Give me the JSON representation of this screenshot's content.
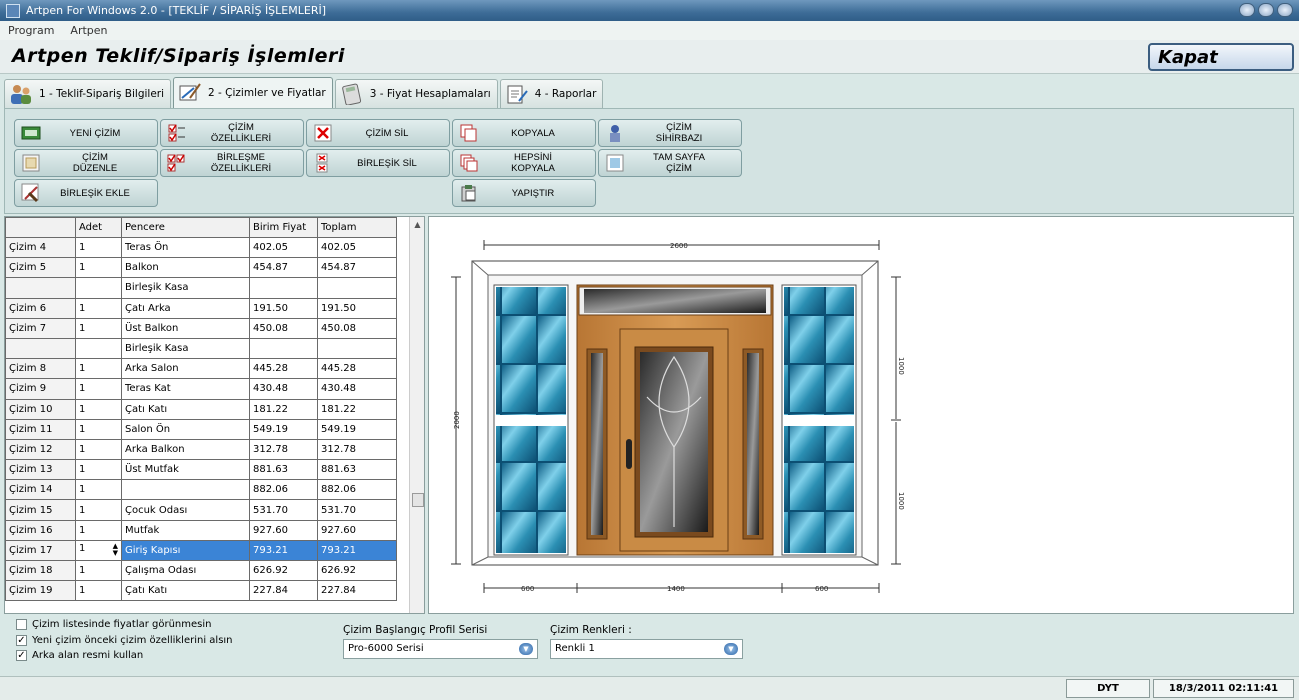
{
  "window": {
    "title": "Artpen For Windows 2.0 - [TEKLİF / SİPARİŞ İŞLEMLERİ]"
  },
  "menu": [
    "Program",
    "Artpen"
  ],
  "header": {
    "title": "Artpen Teklif/Sipariş İşlemleri",
    "close_label": "Kapat"
  },
  "tabs": [
    {
      "label": "1 - Teklif-Sipariş Bilgileri",
      "icon": "people-icon",
      "active": false
    },
    {
      "label": "2 - Çizimler ve Fiyatlar",
      "icon": "drawing-icon",
      "active": true
    },
    {
      "label": "3 - Fiyat Hesaplamaları",
      "icon": "calculator-icon",
      "active": false
    },
    {
      "label": "4 - Raporlar",
      "icon": "report-icon",
      "active": false
    }
  ],
  "toolbar": {
    "yeni_cizim": "YENİ ÇİZİM",
    "cizim_ozellikleri": "ÇİZİM\nÖZELLİKLERİ",
    "cizim_sil": "ÇİZİM SİL",
    "kopyala": "KOPYALA",
    "cizim_sihirbazi": "ÇİZİM\nSİHİRBAZI",
    "cizim_duzenle": "ÇİZİM\nDÜZENLE",
    "birlesme_ozellikleri": "BİRLEŞME\nÖZELLİKLERİ",
    "birlesik_sil": "BİRLEŞİK SİL",
    "hepsini_kopyala": "HEPSİNİ\nKOPYALA",
    "tam_sayfa_cizim": "TAM SAYFA\nÇİZİM",
    "birlesik_ekle": "BİRLEŞİK EKLE",
    "yapistir": "YAPIŞTIR"
  },
  "grid": {
    "columns": [
      "",
      "Adet",
      "Pencere",
      "Birim Fiyat",
      "Toplam"
    ],
    "rows": [
      [
        "Çizim 4",
        "1",
        "Teras Ön",
        "402.05",
        "402.05"
      ],
      [
        "Çizim 5",
        "1",
        "Balkon",
        "454.87",
        "454.87"
      ],
      [
        "",
        "",
        "Birleşik Kasa",
        "",
        ""
      ],
      [
        "Çizim 6",
        "1",
        "Çatı Arka",
        "191.50",
        "191.50"
      ],
      [
        "Çizim 7",
        "1",
        "Üst Balkon",
        "450.08",
        "450.08"
      ],
      [
        "",
        "",
        "Birleşik Kasa",
        "",
        ""
      ],
      [
        "Çizim 8",
        "1",
        "Arka Salon",
        "445.28",
        "445.28"
      ],
      [
        "Çizim 9",
        "1",
        "Teras Kat",
        "430.48",
        "430.48"
      ],
      [
        "Çizim 10",
        "1",
        "Çatı Katı",
        "181.22",
        "181.22"
      ],
      [
        "Çizim 11",
        "1",
        "Salon Ön",
        "549.19",
        "549.19"
      ],
      [
        "Çizim 12",
        "1",
        "Arka Balkon",
        "312.78",
        "312.78"
      ],
      [
        "Çizim 13",
        "1",
        "Üst Mutfak",
        "881.63",
        "881.63"
      ],
      [
        "Çizim 14",
        "1",
        "",
        "882.06",
        "882.06"
      ],
      [
        "Çizim 15",
        "1",
        "Çocuk Odası",
        "531.70",
        "531.70"
      ],
      [
        "Çizim 16",
        "1",
        "Mutfak",
        "927.60",
        "927.60"
      ],
      [
        "Çizim 17",
        "1",
        "Giriş Kapısı",
        "793.21",
        "793.21"
      ],
      [
        "Çizim 18",
        "1",
        "Çalışma Odası",
        "626.92",
        "626.92"
      ],
      [
        "Çizim 19",
        "1",
        "Çatı Katı",
        "227.84",
        "227.84"
      ]
    ],
    "selected_row": 15
  },
  "drawing": {
    "dim_top": "2600",
    "dim_left": "2000",
    "dim_right_top": "1000",
    "dim_right_bottom": "1000",
    "dim_bottom_left": "600",
    "dim_bottom_mid": "1400",
    "dim_bottom_right": "600"
  },
  "options": {
    "hide_prices": {
      "label": "Çizim listesinde fiyatlar görünmesin",
      "checked": false
    },
    "inherit_props": {
      "label": "Yeni çizim önceki çizim özelliklerini alsın",
      "checked": true
    },
    "use_background": {
      "label": "Arka alan resmi kullan",
      "checked": true
    }
  },
  "profile": {
    "label": "Çizim Başlangıç Profil Serisi",
    "value": "Pro-6000 Serisi"
  },
  "colors": {
    "label": "Çizim Renkleri :",
    "value": "Renkli 1"
  },
  "status": {
    "user": "DYT",
    "datetime": "18/3/2011   02:11:41"
  },
  "theme": {
    "accent": "#3b84d6",
    "panel": "#d3e3e2",
    "wood": "#c98b45",
    "glass": "#2b8fb3"
  }
}
